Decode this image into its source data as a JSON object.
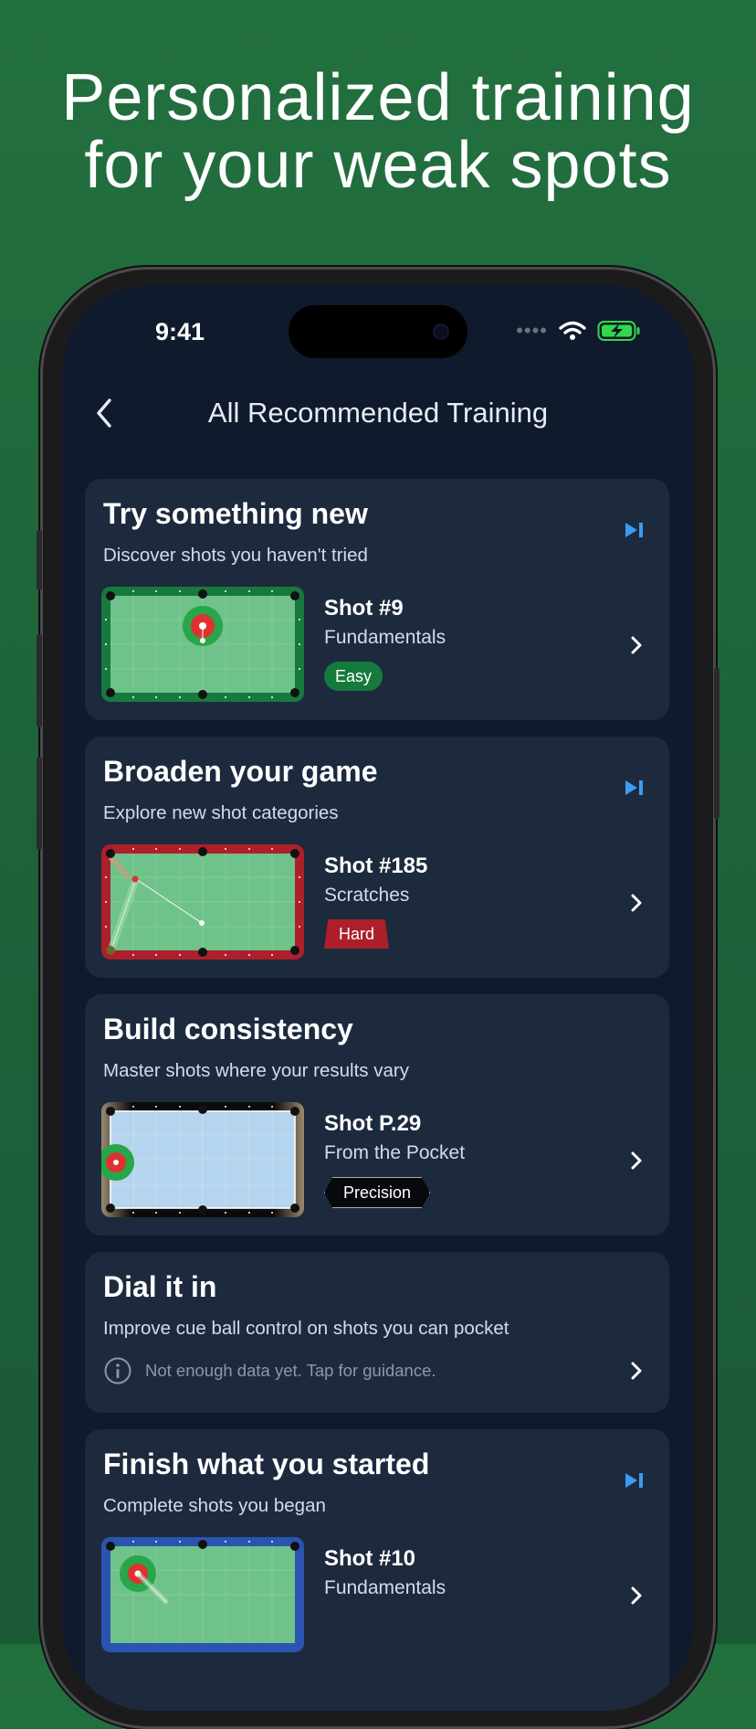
{
  "headline": {
    "line1": "Personalized training",
    "line2": "for your weak spots"
  },
  "status_bar": {
    "time": "9:41",
    "battery_color": "#32d74b"
  },
  "nav": {
    "title": "All Recommended Training",
    "back_icon": "chevron-left-icon"
  },
  "colors": {
    "accent_blue": "#3b9cf0",
    "easy_green": "#167a3d",
    "hard_red": "#ad1f2b",
    "card_bg": "#1d2a3e",
    "screen_bg": "#0f1a2c",
    "felt_green": "#6fc28a"
  },
  "cards": [
    {
      "title": "Try something new",
      "subtitle": "Discover shots you haven't tried",
      "shot_name": "Shot #9",
      "category": "Fundamentals",
      "badge": "Easy",
      "rail_color": "#167a3d"
    },
    {
      "title": "Broaden your game",
      "subtitle": "Explore new shot categories",
      "shot_name": "Shot #185",
      "category": "Scratches",
      "badge": "Hard",
      "rail_color": "#ad1f2b"
    },
    {
      "title": "Build consistency",
      "subtitle": "Master shots where your results vary",
      "shot_name": "Shot P.29",
      "category": "From the Pocket",
      "badge": "Precision",
      "rail_color": "#0b0b0b"
    },
    {
      "title": "Dial it in",
      "subtitle": "Improve cue ball control on shots you can pocket",
      "info": "Not enough data yet. Tap for guidance."
    },
    {
      "title": "Finish what you started",
      "subtitle": "Complete shots you began",
      "shot_name": "Shot #10",
      "category": "Fundamentals",
      "rail_color": "#2a54b0"
    }
  ]
}
